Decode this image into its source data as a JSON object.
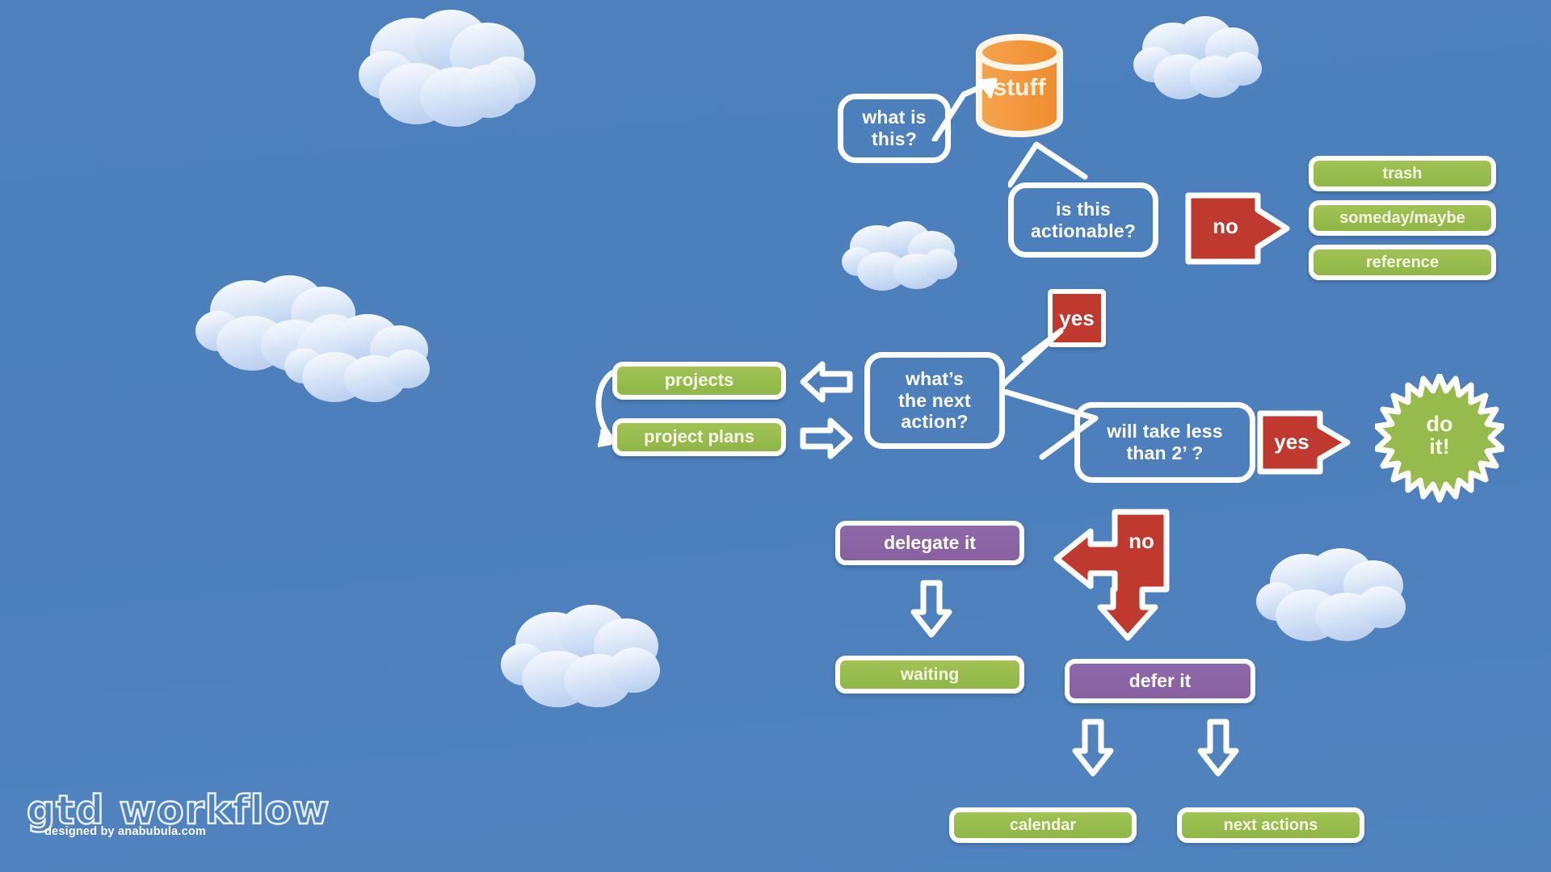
{
  "meta": {
    "title": "gtd workflow",
    "background_color": "#4d80bd"
  },
  "palette": {
    "sky": "#4d80bd",
    "green": "#96bb4c",
    "purple": "#8a63a5",
    "red": "#c0392f",
    "orange": "#f2973d",
    "white": "#ffffff",
    "cream": "#f3f7e2"
  },
  "diagram": {
    "type": "flowchart",
    "nodes": {
      "stuff": {
        "label": "stuff",
        "shape": "cylinder",
        "color": "#f2973d"
      },
      "what_is_this": {
        "label": "what is\nthis?",
        "line1": "what is",
        "line2": "this?",
        "shape": "speech-bubble"
      },
      "is_actionable": {
        "label": "is this\nactionable?",
        "line1": "is this",
        "line2": "actionable?",
        "shape": "speech-bubble"
      },
      "no_1": {
        "label": "no",
        "shape": "badge-arrow-right",
        "color": "#c0392f"
      },
      "trash": {
        "label": "trash",
        "shape": "box",
        "color": "#96bb4c"
      },
      "someday_maybe": {
        "label": "someday/maybe",
        "shape": "box",
        "color": "#96bb4c"
      },
      "reference": {
        "label": "reference",
        "shape": "box",
        "color": "#96bb4c"
      },
      "yes_1": {
        "label": "yes",
        "shape": "badge",
        "color": "#c0392f"
      },
      "next_action": {
        "label": "what's\nthe next\naction?",
        "line1": "what’s",
        "line2": "the next",
        "line3": "action?",
        "shape": "speech-bubble"
      },
      "projects": {
        "label": "projects",
        "shape": "box",
        "color": "#96bb4c"
      },
      "project_plans": {
        "label": "project plans",
        "shape": "box",
        "color": "#96bb4c"
      },
      "less_than_2": {
        "label": "will take less\nthan 2’ ?",
        "line1": "will take less",
        "line2": "than 2’ ?",
        "shape": "speech-bubble"
      },
      "yes_2": {
        "label": "yes",
        "shape": "badge-arrow-right",
        "color": "#c0392f"
      },
      "do_it": {
        "label": "do it!",
        "line1": "do",
        "line2": "it!",
        "shape": "starburst",
        "color": "#96bb4c"
      },
      "no_2": {
        "label": "no",
        "shape": "badge-arrow-left-down",
        "color": "#c0392f"
      },
      "delegate_it": {
        "label": "delegate it",
        "shape": "box",
        "color": "#8a63a5"
      },
      "waiting": {
        "label": "waiting",
        "shape": "box",
        "color": "#96bb4c"
      },
      "defer_it": {
        "label": "defer it",
        "shape": "box",
        "color": "#8a63a5"
      },
      "calendar": {
        "label": "calendar",
        "shape": "box",
        "color": "#96bb4c"
      },
      "next_actions": {
        "label": "next actions",
        "shape": "box",
        "color": "#96bb4c"
      }
    },
    "edges": [
      {
        "from": "stuff",
        "to": "what_is_this",
        "label": ""
      },
      {
        "from": "stuff",
        "to": "is_actionable",
        "label": ""
      },
      {
        "from": "is_actionable",
        "to": "trash",
        "label": "no"
      },
      {
        "from": "is_actionable",
        "to": "someday_maybe",
        "label": "no"
      },
      {
        "from": "is_actionable",
        "to": "reference",
        "label": "no"
      },
      {
        "from": "is_actionable",
        "to": "next_action",
        "label": "yes"
      },
      {
        "from": "next_action",
        "to": "projects",
        "label": ""
      },
      {
        "from": "project_plans",
        "to": "next_action",
        "label": ""
      },
      {
        "from": "projects",
        "to": "project_plans",
        "label": ""
      },
      {
        "from": "next_action",
        "to": "less_than_2",
        "label": ""
      },
      {
        "from": "less_than_2",
        "to": "do_it",
        "label": "yes"
      },
      {
        "from": "less_than_2",
        "to": "delegate_it",
        "label": "no"
      },
      {
        "from": "less_than_2",
        "to": "defer_it",
        "label": "no"
      },
      {
        "from": "delegate_it",
        "to": "waiting",
        "label": ""
      },
      {
        "from": "defer_it",
        "to": "calendar",
        "label": ""
      },
      {
        "from": "defer_it",
        "to": "next_actions",
        "label": ""
      }
    ]
  },
  "logo": {
    "title": "gtd workflow",
    "subtitle": "designed by anabubula.com"
  }
}
